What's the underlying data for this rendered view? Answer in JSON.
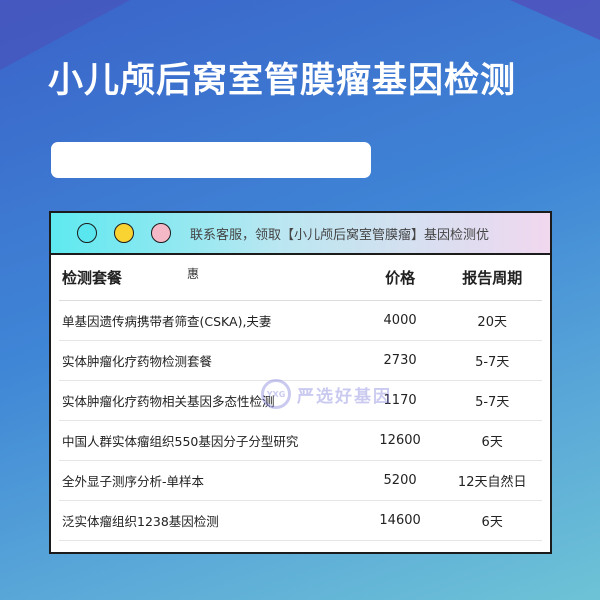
{
  "page": {
    "title": "小儿颅后窝室管膜瘤基因检测"
  },
  "card": {
    "header_text": "联系客服，领取【小儿颅后窝室管膜瘤】基因检测优",
    "header_suffix": "惠",
    "columns": [
      "检测套餐",
      "价格",
      "报告周期"
    ],
    "rows": [
      {
        "name": "单基因遗传病携带者筛查(CSKA),夫妻",
        "price": "4000",
        "period": "20天"
      },
      {
        "name": "实体肿瘤化疗药物检测套餐",
        "price": "2730",
        "period": "5-7天"
      },
      {
        "name": "实体肿瘤化疗药物相关基因多态性检测",
        "price": "1170",
        "period": "5-7天"
      },
      {
        "name": "中国人群实体瘤组织550基因分子分型研究",
        "price": "12600",
        "period": "6天"
      },
      {
        "name": "全外显子测序分析-单样本",
        "price": "5200",
        "period": "12天自然日"
      },
      {
        "name": "泛实体瘤组织1238基因检测",
        "price": "14600",
        "period": "6天"
      }
    ]
  },
  "watermark": {
    "logo_text": "YXG",
    "text": "严选好基因"
  },
  "colors": {
    "dot_1": "#5ae6ee",
    "dot_2": "#f8d331",
    "dot_3": "#f5b8c7"
  }
}
